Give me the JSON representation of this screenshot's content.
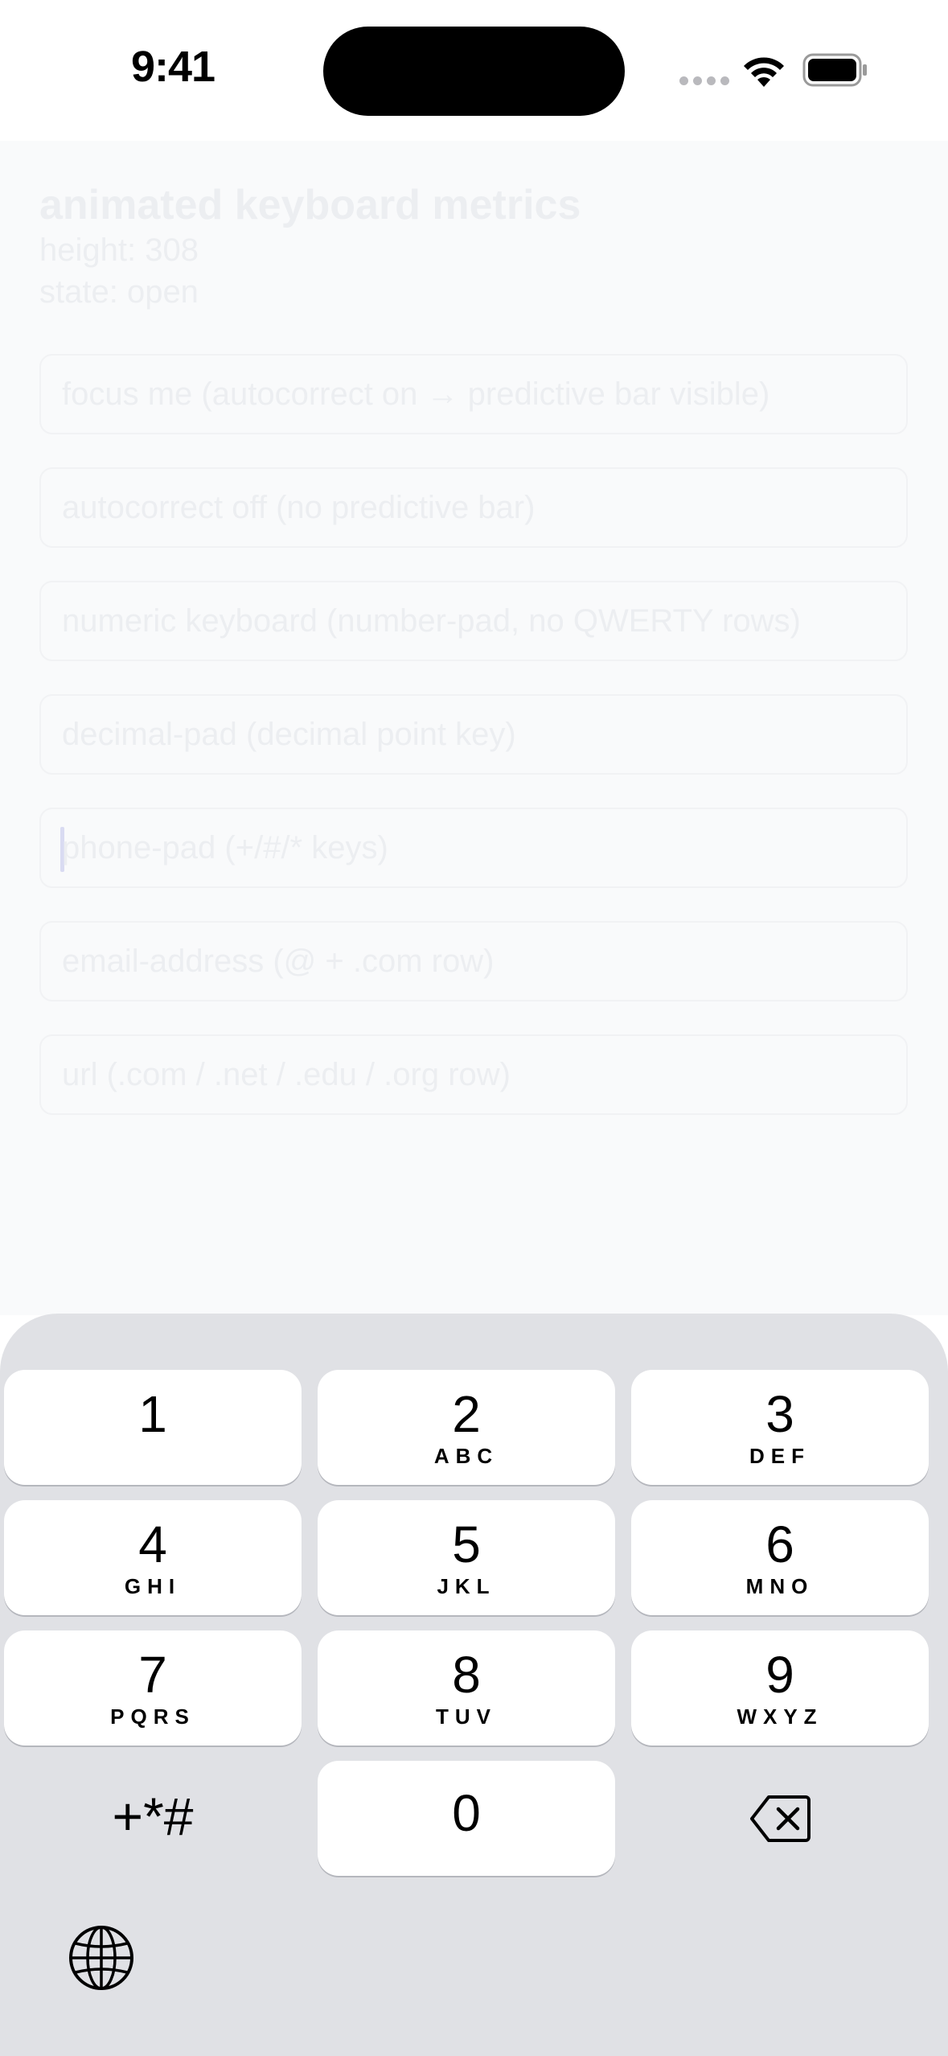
{
  "status_bar": {
    "time": "9:41"
  },
  "metrics": {
    "title": "animated keyboard metrics",
    "height_line": "height: 308",
    "state_line": "state: open"
  },
  "fields": [
    {
      "placeholder": "focus me (autocorrect on → predictive bar visible)"
    },
    {
      "placeholder": "autocorrect off (no predictive bar)"
    },
    {
      "placeholder": "numeric keyboard (number-pad, no QWERTY rows)"
    },
    {
      "placeholder": "decimal-pad (decimal point key)"
    },
    {
      "placeholder": "phone-pad (+/#/* keys)",
      "focused": true
    },
    {
      "placeholder": "email-address (@ + .com row)"
    },
    {
      "placeholder": "url (.com / .net / .edu / .org row)"
    }
  ],
  "keyboard": {
    "keys": [
      {
        "digit": "1",
        "letters": ""
      },
      {
        "digit": "2",
        "letters": "ABC"
      },
      {
        "digit": "3",
        "letters": "DEF"
      },
      {
        "digit": "4",
        "letters": "GHI"
      },
      {
        "digit": "5",
        "letters": "JKL"
      },
      {
        "digit": "6",
        "letters": "MNO"
      },
      {
        "digit": "7",
        "letters": "PQRS"
      },
      {
        "digit": "8",
        "letters": "TUV"
      },
      {
        "digit": "9",
        "letters": "WXYZ"
      },
      {
        "digit": "0",
        "letters": ""
      }
    ],
    "symbols_label": "+*#",
    "backspace_icon": "delete-left-icon",
    "globe_icon": "globe-icon"
  },
  "colors": {
    "content_background": "#f9fafb",
    "keyboard_background": "#e0e1e5",
    "key_background": "#ffffff",
    "caret": "#d9dbf2"
  }
}
